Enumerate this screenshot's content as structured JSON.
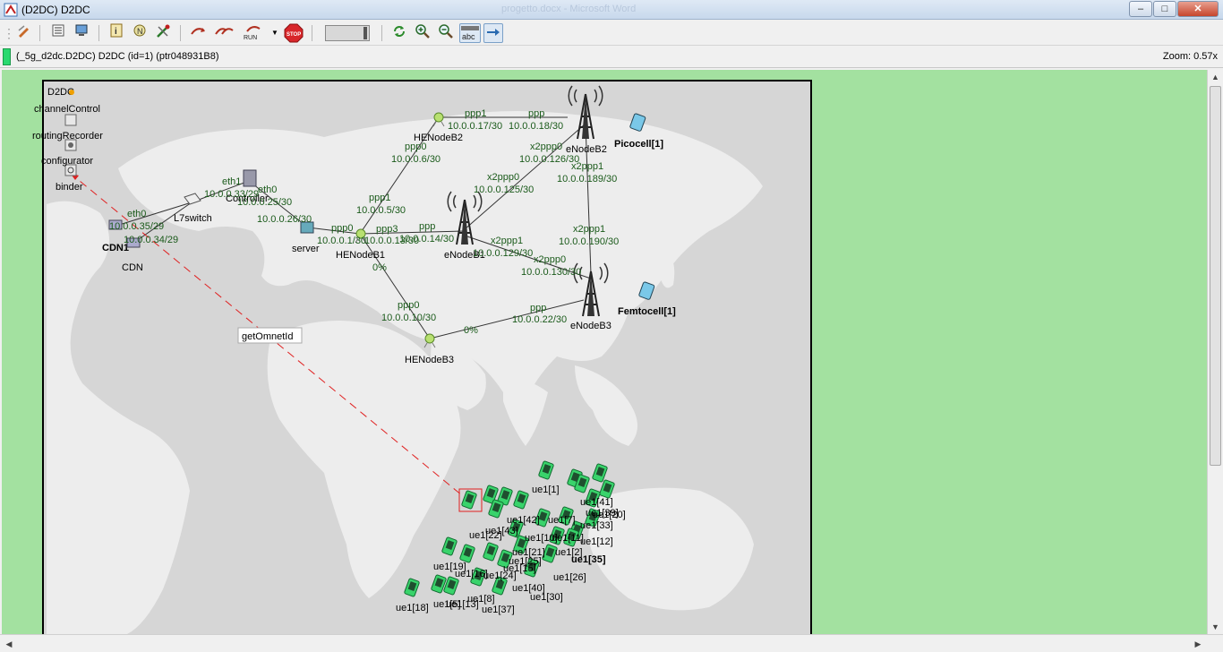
{
  "window": {
    "title": "(D2DC) D2DC",
    "ghost_title": "progetto.docx - Microsoft Word",
    "min_label": "–",
    "max_label": "□",
    "close_label": "✕"
  },
  "toolbar": {
    "icons": [
      "grip-icon",
      "list-icon",
      "monitor-icon",
      "info-icon",
      "network-icon",
      "tools-icon",
      "step-icon",
      "run-fast-icon",
      "run-icon",
      "dropdown-icon",
      "stop-icon",
      "refresh-icon",
      "zoom-in-icon",
      "zoom-out-icon",
      "labels-icon",
      "arrow-icon"
    ],
    "run_label": "RUN",
    "stop_label": "STOP",
    "labels_toggle": "abc"
  },
  "infobar": {
    "path": "(_5g_d2dc.D2DC) D2DC  (id=1)  (ptr048931B8)",
    "zoom": "Zoom: 0.57x"
  },
  "network": {
    "title": "D2DC",
    "modules": {
      "channelControl": "channelControl",
      "routingRecorder": "routingRecorder",
      "configurator": "configurator",
      "binder": "binder",
      "L7switch": "L7switch",
      "Controller": "Controller",
      "CDN1": "CDN1",
      "CDN": "CDN",
      "server": "server",
      "HENodeB1": "HENodeB1",
      "HENodeB2": "HENodeB2",
      "HENodeB3": "HENodeB3",
      "eNodeB1": "eNodeB1",
      "eNodeB2": "eNodeB2",
      "eNodeB3": "eNodeB3",
      "picocell": "Picocell[1]",
      "femtocell": "Femtocell[1]"
    },
    "link_labels": {
      "ppp1_top": "ppp1",
      "ip_17": "10.0.0.17/30",
      "ppp_top": "ppp",
      "ip_18": "10.0.0.18/30",
      "ppp0_hb2": "ppp0",
      "ip_6": "10.0.0.6/30",
      "x2ppp0_e2": "x2ppp0",
      "ip_126": "10.0.0.126/30",
      "x2ppp0_e1": "x2ppp0",
      "ip_125": "10.0.0.125/30",
      "x2ppp1_e2": "x2ppp1",
      "ip_189": "10.0.0.189/30",
      "ppp1_hb1": "ppp1",
      "ip_5": "10.0.0.5/30",
      "eth1": "eth1",
      "ip_33": "10.0.0.33/29",
      "eth0_c": "eth0",
      "ip_25": "10.0.0.25/30",
      "eth0_cdn": "eth0",
      "ip_35": "10.0.0.35/29",
      "eth0_cdn1": "eth0",
      "ip_34": "10.0.0.34/29",
      "ip_26": "10.0.0.26/30",
      "ppp0_srv": "ppp0",
      "ip_1": "10.0.0.1/30",
      "ppp3": "ppp3",
      "ip_13": "10.0.0.13/30",
      "ppp_e1": "ppp",
      "ip_14": "10.0.0.14/30",
      "x2ppp1_e1": "x2ppp1",
      "ip_129": "10.0.0.129/30",
      "x2ppp1_e3": "x2ppp1",
      "ip_190": "10.0.0.190/30",
      "x2ppp0_e3": "x2ppp0",
      "ip_130": "10.0.0.130/30",
      "ppp0_hb3": "ppp0",
      "ip_10": "10.0.0.10/30",
      "ppp_e3": "ppp",
      "ip_22": "10.0.0.22/30",
      "pct_hb1": "0%",
      "pct_hb3": "0%"
    },
    "message_label": "getOmnetId",
    "ue_labels": [
      "ue1[1]",
      "ue1[41]",
      "ue1[39]",
      "ue1[20]",
      "ue1[33]",
      "ue1[42]",
      "ue1[7]",
      "ue1[43]",
      "ue1[22]",
      "ue1[12]",
      "ue1[10]",
      "ue1[11]",
      "ue1[35]",
      "ue1[2]",
      "ue1[21]",
      "ue1[25]",
      "ue1[15]",
      "ue1[19]",
      "ue1[24]",
      "ue1[26]",
      "ue1[40]",
      "ue1[30]",
      "ue1[18]",
      "ue1[5]",
      "ue1[13]",
      "ue1[37]",
      "ue1[8]",
      "ue1[16]"
    ]
  },
  "colors": {
    "canvas_bg": "#a3e1a0",
    "map_bg": "#d6d6d6",
    "land": "#ededed",
    "link_label": "#1a5a1a",
    "message_line": "#e02020",
    "ue_green": "#39d36b"
  }
}
